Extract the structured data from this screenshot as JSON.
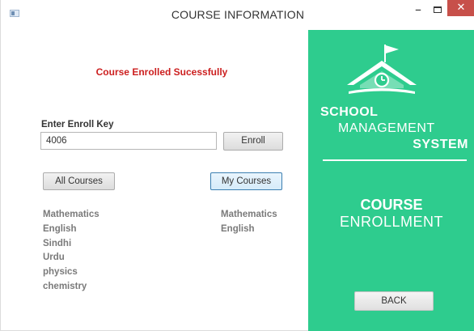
{
  "window": {
    "title": "COURSE INFORMATION",
    "min_glyph": "–",
    "close_glyph": "✕"
  },
  "colors": {
    "accent": "#2ecc8e",
    "success_text": "#cc1f1f",
    "list_text": "#7a7a7a"
  },
  "status": {
    "message": "Course Enrolled Sucessfully"
  },
  "enroll": {
    "label": "Enter Enroll Key",
    "value": "4006",
    "button_label": "Enroll"
  },
  "buttons": {
    "all_courses": "All Courses",
    "my_courses": "My Courses",
    "back": "BACK"
  },
  "all_courses": [
    "Mathematics",
    "English",
    "Sindhi",
    "Urdu",
    "physics",
    "chemistry"
  ],
  "my_courses": [
    "Mathematics",
    "English"
  ],
  "side_panel": {
    "brand_line1": "SCHOOL",
    "brand_line2": "MANAGEMENT",
    "brand_line3": "SYSTEM",
    "heading_line1": "COURSE",
    "heading_line2": "ENROLLMENT",
    "logo_icon": "school-building-icon"
  }
}
